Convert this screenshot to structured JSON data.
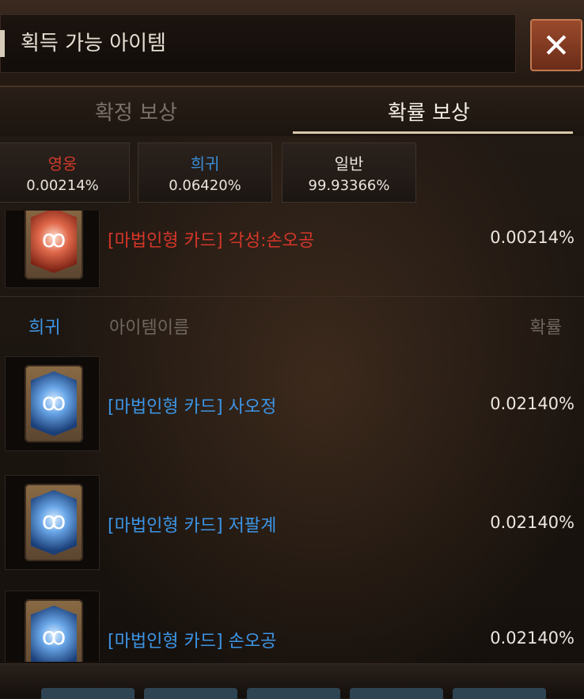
{
  "header": {
    "title": "획득 가능 아이템",
    "close_icon": "close-icon"
  },
  "tabs": [
    {
      "label": "확정 보상",
      "active": false
    },
    {
      "label": "확률 보상",
      "active": true
    }
  ],
  "rarities": [
    {
      "name": "영웅",
      "pct": "0.00214%",
      "color": "#d03b2a"
    },
    {
      "name": "희귀",
      "pct": "0.06420%",
      "color": "#3a8ed8"
    },
    {
      "name": "일반",
      "pct": "99.93366%",
      "color": "#e9e4dc"
    }
  ],
  "hero_item": {
    "name": "[마법인형 카드] 각성:손오공",
    "pct": "0.00214%",
    "icon": "red-doll-card-icon"
  },
  "rare_section": {
    "rarity_label": "희귀",
    "name_header": "아이템이름",
    "prob_header": "확률",
    "items": [
      {
        "name": "[마법인형 카드] 사오정",
        "pct": "0.02140%",
        "icon": "blue-doll-card-icon"
      },
      {
        "name": "[마법인형 카드] 저팔계",
        "pct": "0.02140%",
        "icon": "blue-doll-card-icon"
      },
      {
        "name": "[마법인형 카드] 손오공",
        "pct": "0.02140%",
        "icon": "blue-doll-card-icon"
      }
    ]
  },
  "colors": {
    "hero": "#d6362a",
    "rare": "#3c95e6"
  }
}
